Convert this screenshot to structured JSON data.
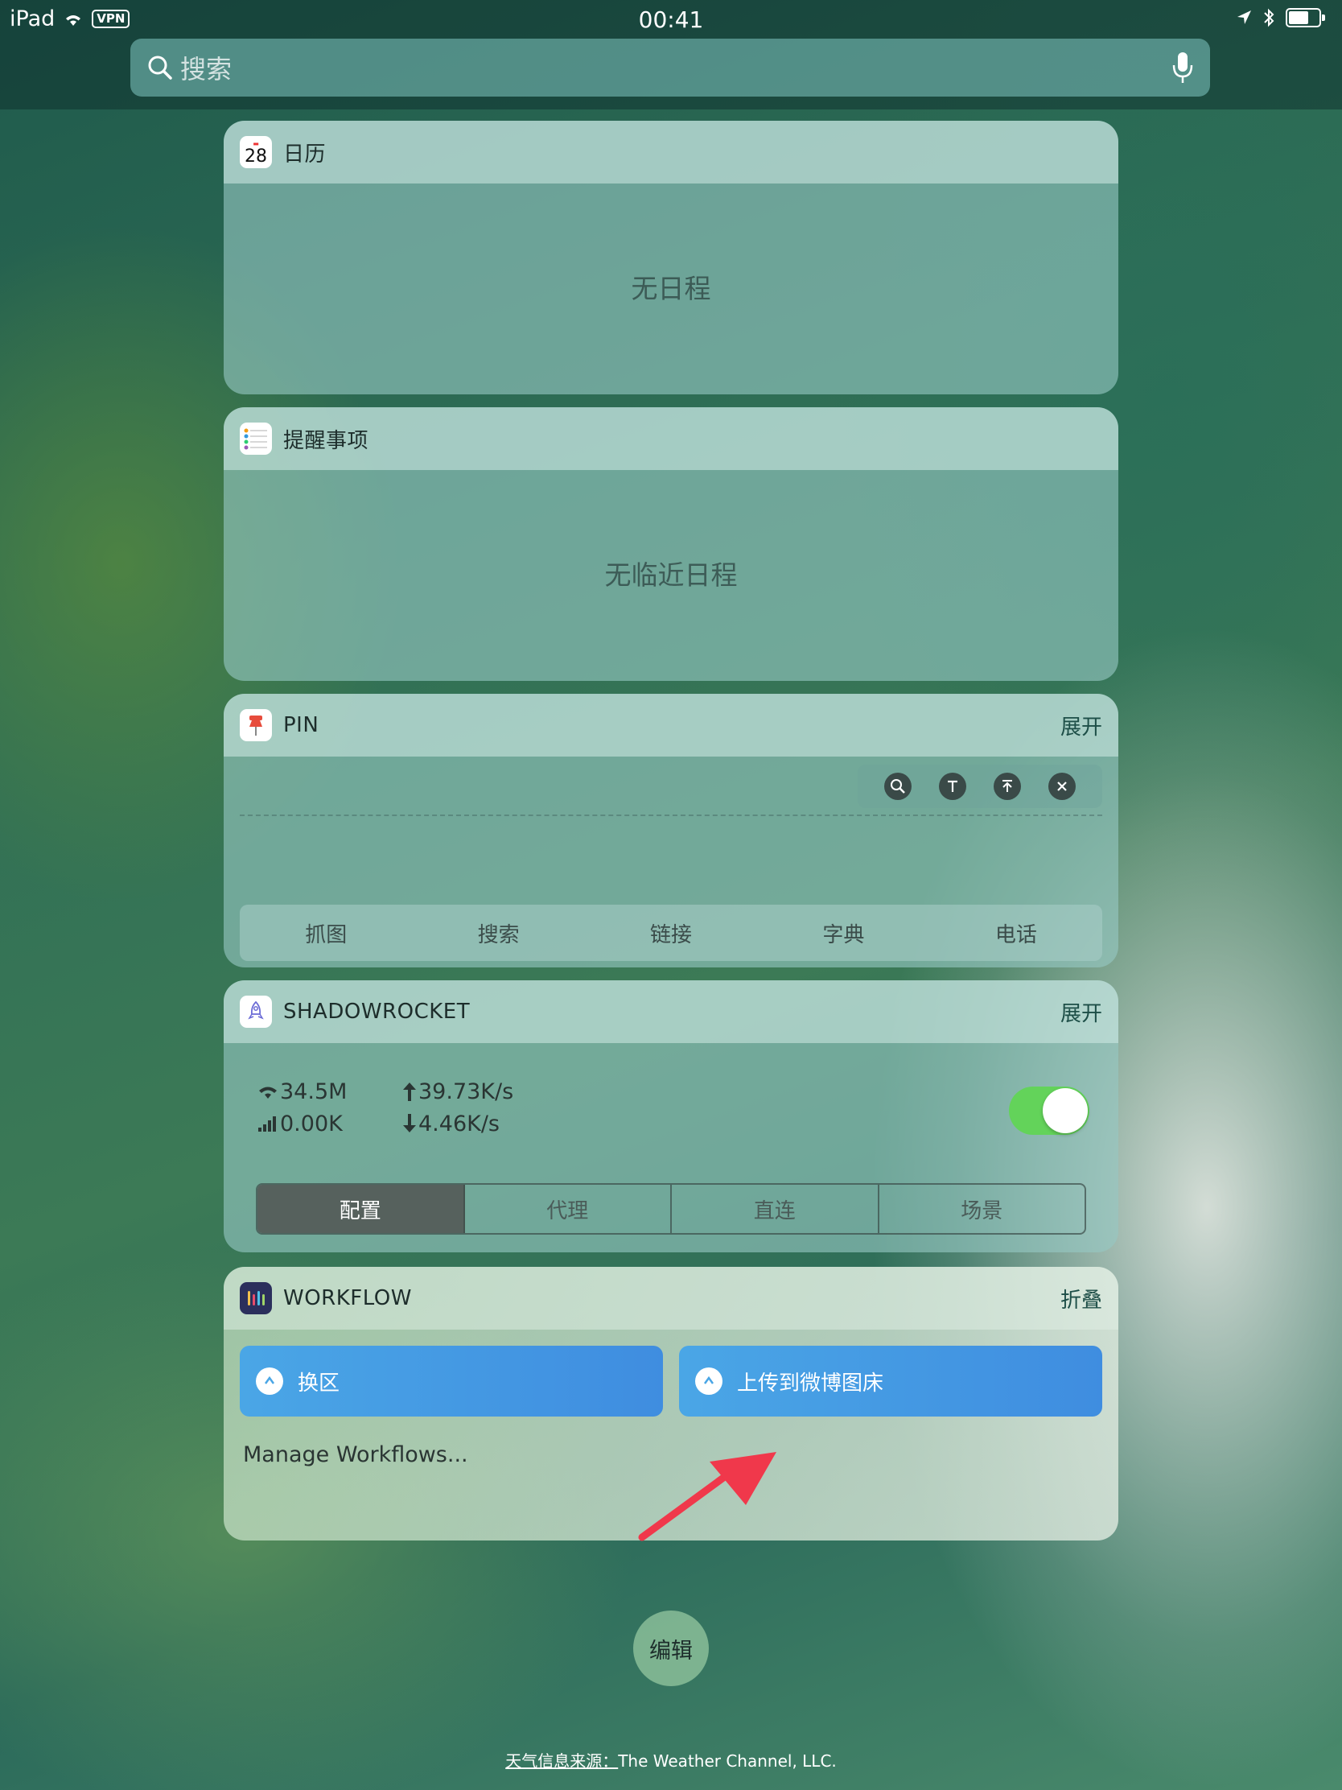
{
  "status_bar": {
    "device": "iPad",
    "vpn": "VPN",
    "time": "00:41"
  },
  "search": {
    "placeholder": "搜索"
  },
  "widgets": {
    "calendar": {
      "title": "日历",
      "icon_day": "28",
      "empty_text": "无日程"
    },
    "reminders": {
      "title": "提醒事项",
      "empty_text": "无临近日程"
    },
    "pin": {
      "title": "PIN",
      "action": "展开",
      "tools": [
        "search-icon",
        "text-icon",
        "top-icon",
        "close-icon"
      ],
      "tabs": [
        "抓图",
        "搜索",
        "链接",
        "字典",
        "电话"
      ]
    },
    "shadowrocket": {
      "title": "SHADOWROCKET",
      "action": "展开",
      "wifi_total": "34.5M",
      "cell_total": "0.00K",
      "upload": "39.73K/s",
      "download": "4.46K/s",
      "toggle_on": true,
      "segments": [
        "配置",
        "代理",
        "直连",
        "场景"
      ],
      "active_segment": "配置"
    },
    "workflow": {
      "title": "WORKFLOW",
      "action": "折叠",
      "buttons": [
        "换区",
        "上传到微博图床"
      ],
      "manage": "Manage Workflows..."
    }
  },
  "edit_button": "编辑",
  "footer": {
    "source_label": "天气信息来源：",
    "source": "The Weather Channel, LLC."
  },
  "colors": {
    "toggle": "#63d35a",
    "workflow_button": "#4aa6e6",
    "annotation_arrow": "#f0384b"
  }
}
